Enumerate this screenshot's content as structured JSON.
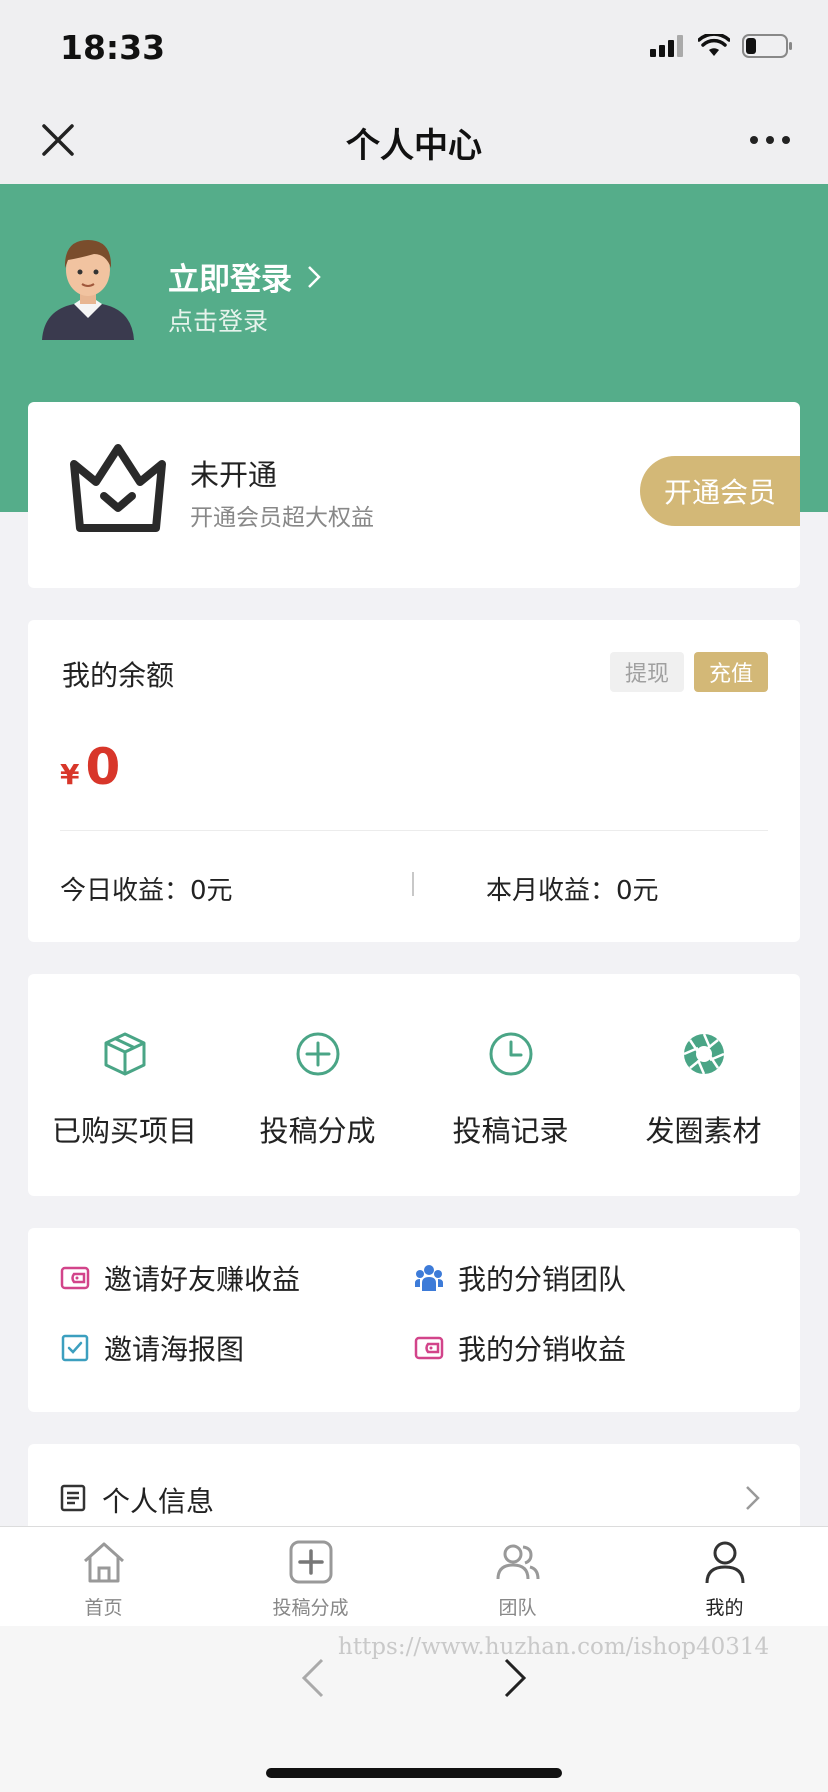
{
  "status": {
    "time": "18:33"
  },
  "nav": {
    "title": "个人中心"
  },
  "profile": {
    "login_title": "立即登录",
    "login_sub": "点击登录"
  },
  "vip": {
    "title": "未开通",
    "subtitle": "开通会员超大权益",
    "button": "开通会员"
  },
  "balance": {
    "title": "我的余额",
    "withdraw": "提现",
    "recharge": "充值",
    "currency": "¥",
    "amount": "0",
    "today_earnings": "今日收益：0元",
    "month_earnings": "本月收益：0元"
  },
  "functions": [
    {
      "label": "已购买项目",
      "icon": "box-icon"
    },
    {
      "label": "投稿分成",
      "icon": "plus-circle-icon"
    },
    {
      "label": "投稿记录",
      "icon": "clock-icon"
    },
    {
      "label": "发圈素材",
      "icon": "aperture-icon"
    }
  ],
  "share": [
    {
      "label": "邀请好友赚收益",
      "icon": "wallet-icon"
    },
    {
      "label": "我的分销团队",
      "icon": "team-icon"
    },
    {
      "label": "邀请海报图",
      "icon": "checkbox-icon"
    },
    {
      "label": "我的分销收益",
      "icon": "wallet-icon"
    }
  ],
  "info": {
    "label": "个人信息"
  },
  "tabs": [
    {
      "label": "首页",
      "icon": "home-icon"
    },
    {
      "label": "投稿分成",
      "icon": "plus-square-icon"
    },
    {
      "label": "团队",
      "icon": "users-icon"
    },
    {
      "label": "我的",
      "icon": "user-icon"
    }
  ],
  "browser": {
    "watermark": "https://www.huzhan.com/ishop40314"
  },
  "colors": {
    "header_green": "#55ad8a",
    "gold": "#d3b877",
    "accent_red": "#d8362a",
    "icon_green": "#4aa586"
  }
}
